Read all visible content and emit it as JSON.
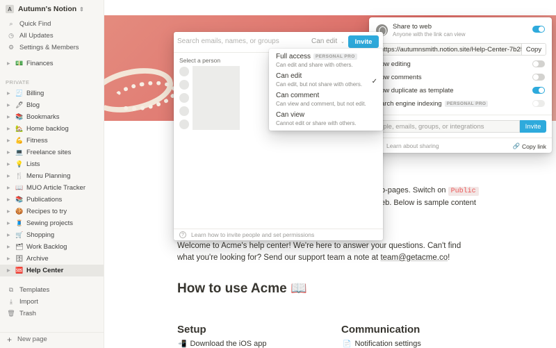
{
  "sidebar": {
    "workspace": "Autumn's Notion",
    "workspace_initial": "A",
    "nav": [
      {
        "label": "Quick Find",
        "icon": "search-icon"
      },
      {
        "label": "All Updates",
        "icon": "clock-icon"
      },
      {
        "label": "Settings & Members",
        "icon": "gear-icon"
      }
    ],
    "top_pages": [
      {
        "label": "Finances",
        "emoji": "💵"
      }
    ],
    "section": "PRIVATE",
    "pages": [
      {
        "label": "Billing",
        "emoji": "🧾"
      },
      {
        "label": "Blog",
        "emoji": "🖊"
      },
      {
        "label": "Bookmarks",
        "emoji": "📚"
      },
      {
        "label": "Home backlog",
        "emoji": "🏡"
      },
      {
        "label": "Fitness",
        "emoji": "💪"
      },
      {
        "label": "Freelance sites",
        "emoji": "💻"
      },
      {
        "label": "Lists",
        "emoji": "💡"
      },
      {
        "label": "Menu Planning",
        "emoji": "🍴"
      },
      {
        "label": "MUO Article Tracker",
        "emoji": "📖"
      },
      {
        "label": "Publications",
        "emoji": "📚"
      },
      {
        "label": "Recipes to try",
        "emoji": "🍪"
      },
      {
        "label": "Sewing projects",
        "emoji": "🧵"
      },
      {
        "label": "Shopping",
        "emoji": "🛒"
      },
      {
        "label": "Work Backlog",
        "emoji": "🗂"
      },
      {
        "label": "Archive",
        "emoji": "🗄"
      },
      {
        "label": "Help Center",
        "emoji": "🆘"
      }
    ],
    "bottom": [
      {
        "label": "Templates",
        "icon": "templates-icon"
      },
      {
        "label": "Import",
        "icon": "import-icon"
      },
      {
        "label": "Trash",
        "icon": "trash-icon"
      }
    ],
    "new_page": "New page"
  },
  "page": {
    "callout_line1": "b-pages. Switch on ",
    "callout_code": "Public",
    "callout_line2": "eb. Below is sample content",
    "welcome_text": "Welcome to Acme's help center! We're here to answer your questions. Can't find what you're looking for? Send our support team a note at ",
    "welcome_link": "team@getacme.co",
    "welcome_end": "!",
    "heading": "How to use Acme 📖",
    "col1_heading": "Setup",
    "col1_item": "Download the iOS app",
    "col2_heading": "Communication",
    "col2_item": "Notification settings"
  },
  "share_panel": {
    "title": "Share to web",
    "subtitle": "Anyone with the link can view",
    "url": "https://autumnsmith.notion.site/Help-Center-7b25",
    "copy": "Copy",
    "options": [
      {
        "label": "ow editing",
        "on": false
      },
      {
        "label": "ow comments",
        "on": false
      },
      {
        "label": "ow duplicate as template",
        "on": true
      },
      {
        "label": "arch engine indexing",
        "on": false,
        "badge": "PERSONAL PRO"
      }
    ],
    "invite_placeholder": "ople, emails, groups, or integrations",
    "invite_button": "Invite",
    "learn": "Learn about sharing",
    "copy_link": "Copy link"
  },
  "invite_modal": {
    "search_placeholder": "Search emails, names, or groups",
    "permission": "Can edit",
    "invite_button": "Invite",
    "select_label": "Select a person",
    "footer": "Learn how to invite people and set permissions"
  },
  "permission_menu": [
    {
      "title": "Full access",
      "badge": "PERSONAL PRO",
      "desc": "Can edit and share with others.",
      "selected": false
    },
    {
      "title": "Can edit",
      "desc": "Can edit, but not share with others.",
      "selected": true
    },
    {
      "title": "Can comment",
      "desc": "Can view and comment, but not edit.",
      "selected": false
    },
    {
      "title": "Can view",
      "desc": "Cannot edit or share with others.",
      "selected": false
    }
  ],
  "colors": {
    "accent": "#2eaadc",
    "sidebar_bg": "#f7f6f3",
    "code_red": "#eb5757"
  }
}
